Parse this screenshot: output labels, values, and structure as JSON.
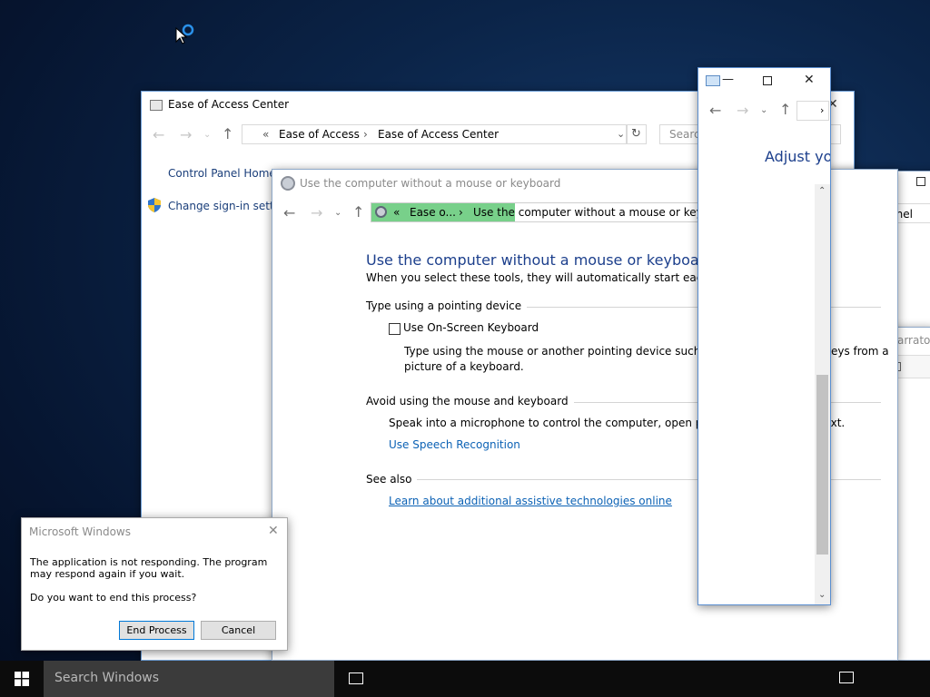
{
  "ease_window": {
    "title": "Ease of Access Center",
    "breadcrumb_chevrons": "«",
    "crumb_1": "Ease of Access",
    "crumb_sep": "›",
    "crumb_2": "Ease of Access Center",
    "search_placeholder": "Search",
    "nav_home": "Control Panel Home",
    "nav_change_signin": "Change sign-in settings",
    "close_glyph": "✕"
  },
  "main_window": {
    "title": "Use the computer without a mouse or keyboard",
    "breadcrumb_chevrons": "«",
    "crumb_1": "Ease o...",
    "crumb_sep": "›",
    "crumb_2": "Use the computer without a mouse or keyboard",
    "heading": "Use the computer without a mouse or keyboard",
    "intro": "When you select these tools, they will automatically start each time you sign in.",
    "section_pointing": "Type using a pointing device",
    "osk_checkbox_label": "Use On-Screen Keyboard",
    "osk_checked": false,
    "osk_desc_1": "Type using the mouse or another pointing device such as a joystick to select keys from a",
    "osk_desc_2": "picture of a keyboard.",
    "section_avoid": "Avoid using the mouse and keyboard",
    "speech_desc": "Speak into a microphone to control the computer, open programs, and dictate text.",
    "speech_link": "Use Speech Recognition",
    "section_see_also": "See also",
    "see_also_link": "Learn about additional assistive technologies online"
  },
  "right_window": {
    "crumb_tail": "n Control Panel"
  },
  "narrator_window": {
    "title": "Narrato"
  },
  "small_window": {
    "content_text": "Adjust yo"
  },
  "dialog": {
    "title": "Microsoft Windows",
    "message_1": "The application is not responding. The program may respond again if you wait.",
    "message_2": "Do you want to end this process?",
    "end_process": "End Process",
    "cancel": "Cancel"
  },
  "taskbar": {
    "search_placeholder": "Search Windows"
  }
}
